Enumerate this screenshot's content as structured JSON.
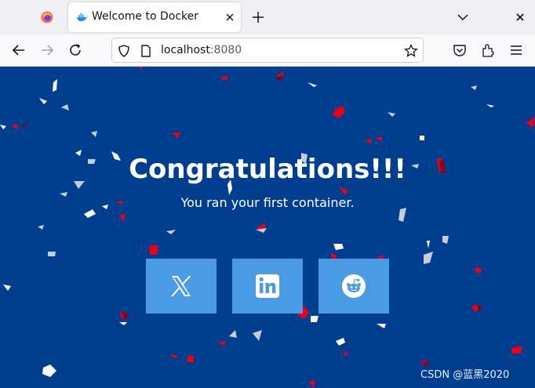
{
  "browser": {
    "tab_title": "Welcome to Docker",
    "url_host": "localhost",
    "url_port": ":8080"
  },
  "page": {
    "heading": "Congratulations!!!",
    "subheading": "You ran your first container.",
    "social_links": [
      {
        "name": "x",
        "icon": "x-icon"
      },
      {
        "name": "linkedin",
        "icon": "linkedin-icon"
      },
      {
        "name": "reddit",
        "icon": "reddit-icon"
      }
    ],
    "background_color": "#003f8f",
    "button_color": "#4a9be4"
  },
  "watermark": "CSDN @蓝黑2020"
}
